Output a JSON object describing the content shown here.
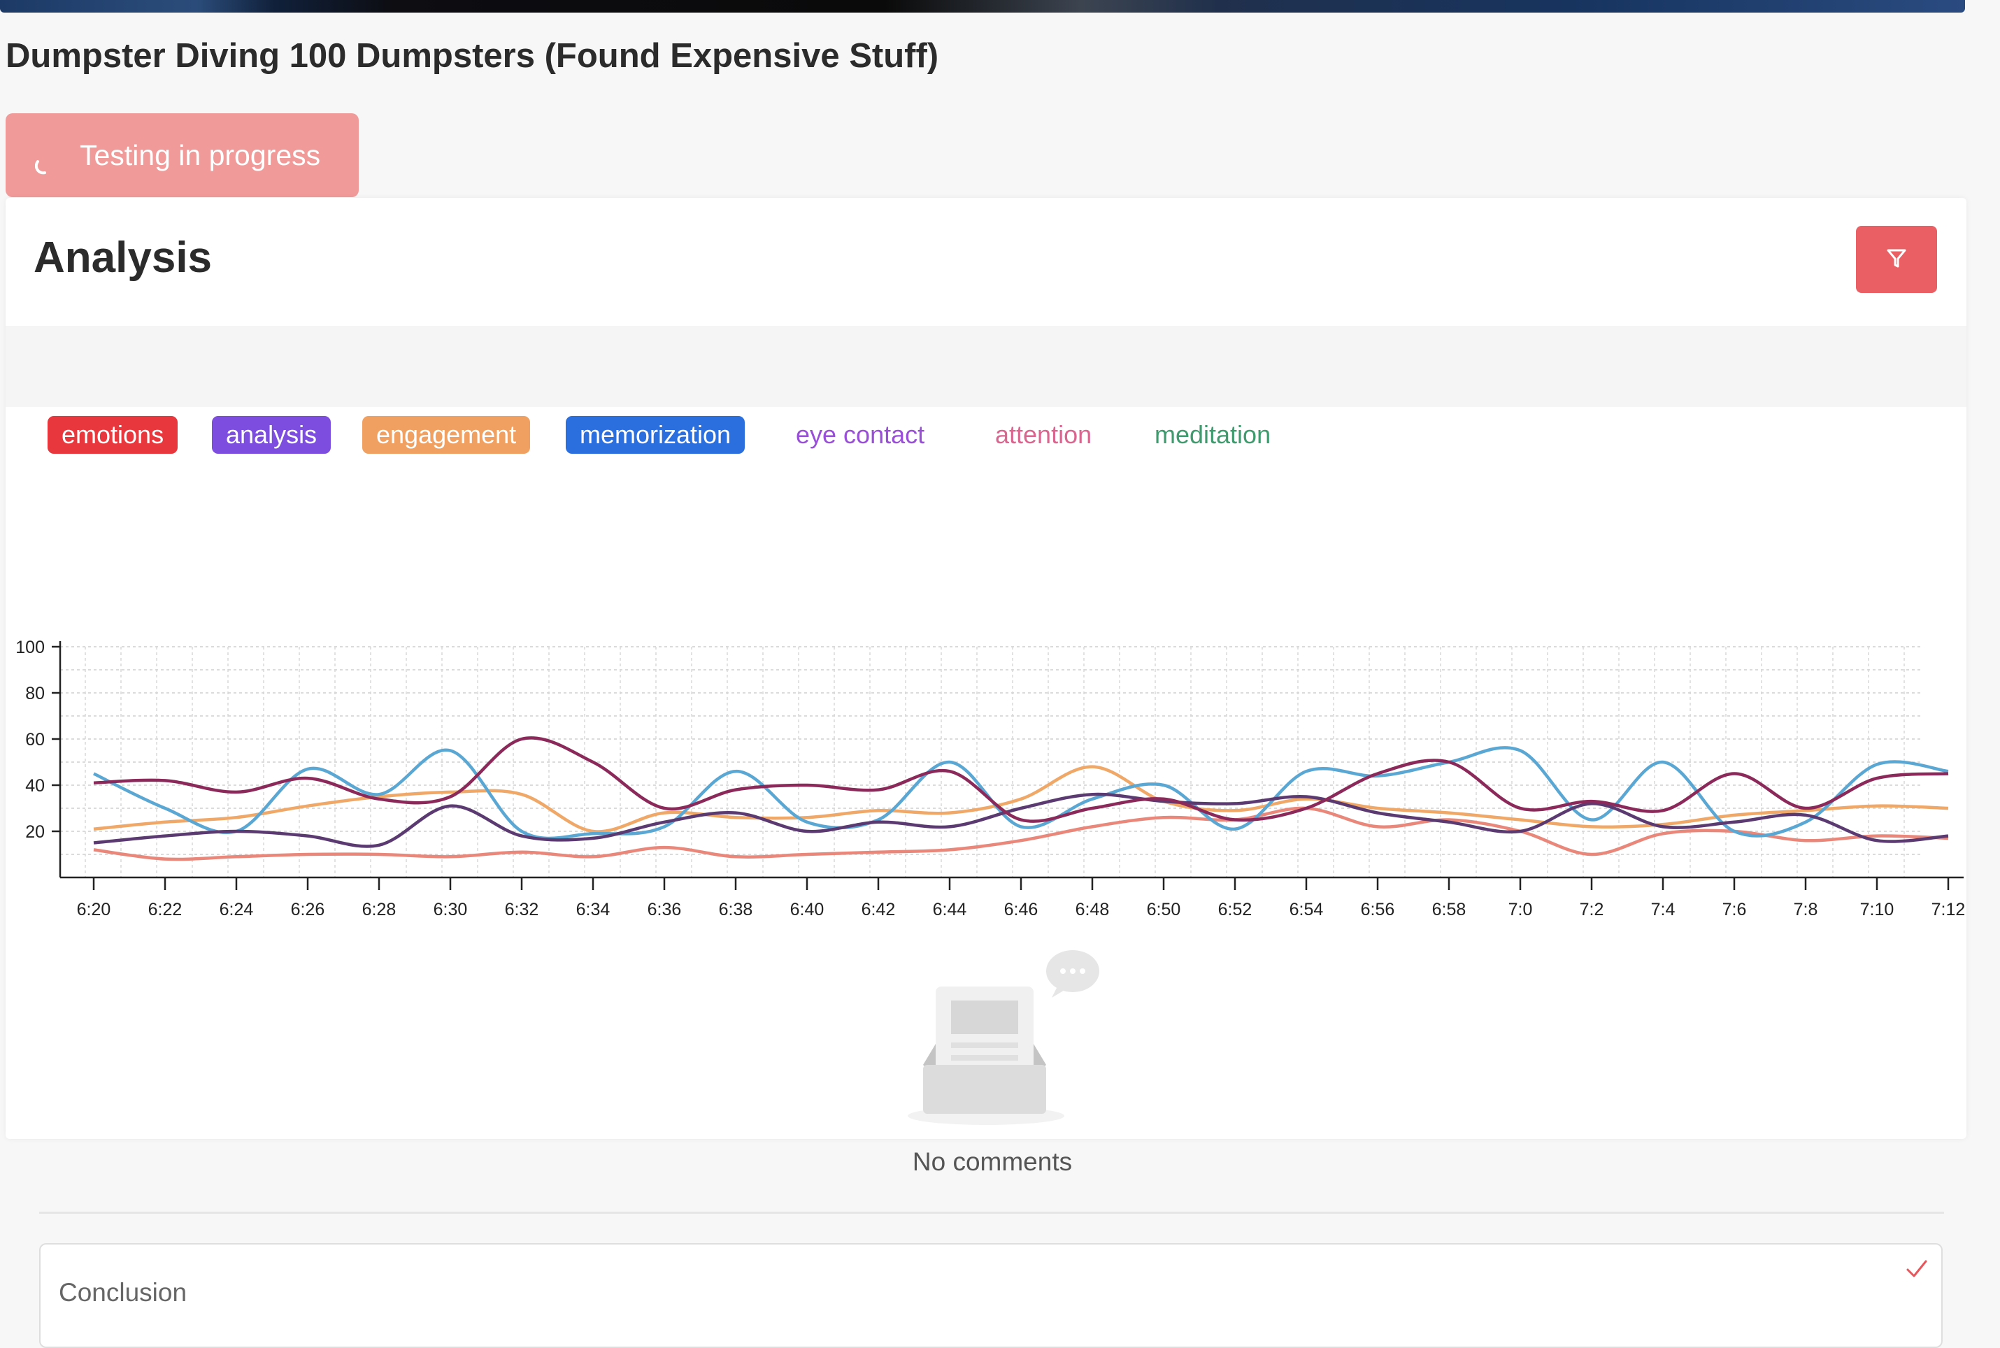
{
  "video": {
    "title": "Dumpster Diving 100 Dumpsters (Found Expensive Stuff)"
  },
  "status": {
    "label": "Testing in progress",
    "color": "#f19a9a",
    "icon": "spinner-icon"
  },
  "panel": {
    "title": "Analysis",
    "filter_icon": "filter-icon",
    "filter_color": "#e95f63"
  },
  "tabs": [
    {
      "label": "emotions",
      "bg": "#e8383d",
      "fg": "#ffffff"
    },
    {
      "label": "analysis",
      "bg": "#7c4dde",
      "fg": "#ffffff"
    },
    {
      "label": "engagement",
      "bg": "#f0a060",
      "fg": "#ffffff"
    },
    {
      "label": "memorization",
      "bg": "#2b6fde",
      "fg": "#ffffff"
    },
    {
      "label": "eye contact",
      "bg": "transparent",
      "fg": "#9a4fd8"
    },
    {
      "label": "attention",
      "bg": "transparent",
      "fg": "#d9668f"
    },
    {
      "label": "meditation",
      "bg": "transparent",
      "fg": "#3f9a6e"
    }
  ],
  "chart_data": {
    "type": "line",
    "x": [
      "6:20",
      "6:22",
      "6:24",
      "6:26",
      "6:28",
      "6:30",
      "6:32",
      "6:34",
      "6:36",
      "6:38",
      "6:40",
      "6:42",
      "6:44",
      "6:46",
      "6:48",
      "6:50",
      "6:52",
      "6:54",
      "6:56",
      "6:58",
      "7:0",
      "7:2",
      "7:4",
      "7:6",
      "7:8",
      "7:10",
      "7:12"
    ],
    "y_ticks": [
      20,
      40,
      60,
      80,
      100
    ],
    "ylim": [
      0,
      100
    ],
    "grid": true,
    "series": [
      {
        "color": "#e8877a",
        "values": [
          12,
          8,
          9,
          10,
          10,
          9,
          11,
          9,
          13,
          9,
          10,
          11,
          12,
          16,
          22,
          26,
          25,
          30,
          22,
          25,
          20,
          10,
          19,
          20,
          16,
          18,
          17
        ]
      },
      {
        "color": "#f0a868",
        "values": [
          21,
          24,
          26,
          31,
          35,
          37,
          36,
          20,
          28,
          26,
          26,
          29,
          28,
          34,
          48,
          33,
          29,
          34,
          30,
          28,
          25,
          22,
          23,
          27,
          29,
          31,
          30
        ]
      },
      {
        "color": "#5aa7d4",
        "values": [
          45,
          30,
          20,
          47,
          36,
          55,
          20,
          19,
          22,
          46,
          24,
          25,
          50,
          22,
          34,
          40,
          21,
          46,
          44,
          50,
          55,
          25,
          50,
          20,
          24,
          49,
          46
        ]
      },
      {
        "color": "#5a3a70",
        "values": [
          15,
          18,
          20,
          18,
          14,
          31,
          18,
          17,
          24,
          28,
          20,
          24,
          22,
          30,
          36,
          33,
          32,
          35,
          28,
          24,
          20,
          32,
          22,
          24,
          27,
          16,
          18
        ]
      },
      {
        "color": "#8b2a5a",
        "values": [
          41,
          42,
          37,
          43,
          34,
          35,
          60,
          50,
          30,
          38,
          40,
          38,
          46,
          25,
          30,
          34,
          25,
          30,
          45,
          50,
          30,
          33,
          29,
          45,
          30,
          43,
          45
        ]
      }
    ]
  },
  "empty": {
    "text": "No comments",
    "icon": "empty-inbox-icon"
  },
  "conclusion": {
    "label": "Conclusion",
    "icon": "check-icon"
  }
}
